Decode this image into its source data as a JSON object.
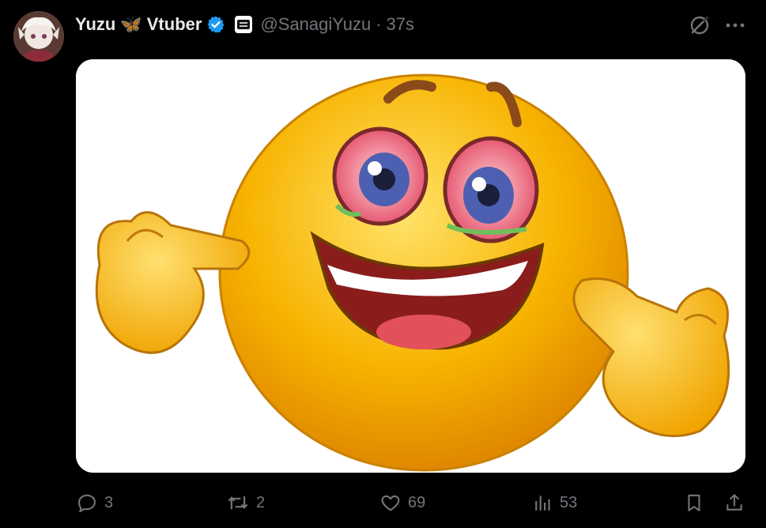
{
  "tweet": {
    "author": {
      "name_part1": "Yuzu",
      "emoji": "🦋",
      "name_part2": "Vtuber",
      "handle": "@SanagiYuzu",
      "separator": "·",
      "time": "37s",
      "verified_color": "#1d9bf0"
    },
    "media": {
      "description": "emoji",
      "face_color": "#f7b300"
    },
    "actions": {
      "replies": "3",
      "reposts": "2",
      "likes": "69",
      "views": "53"
    }
  },
  "icons": [
    "grok-icon",
    "more-icon",
    "reply-icon",
    "repost-icon",
    "like-icon",
    "views-icon",
    "bookmark-icon",
    "share-icon",
    "verified-badge-icon",
    "affiliate-badge-icon"
  ]
}
